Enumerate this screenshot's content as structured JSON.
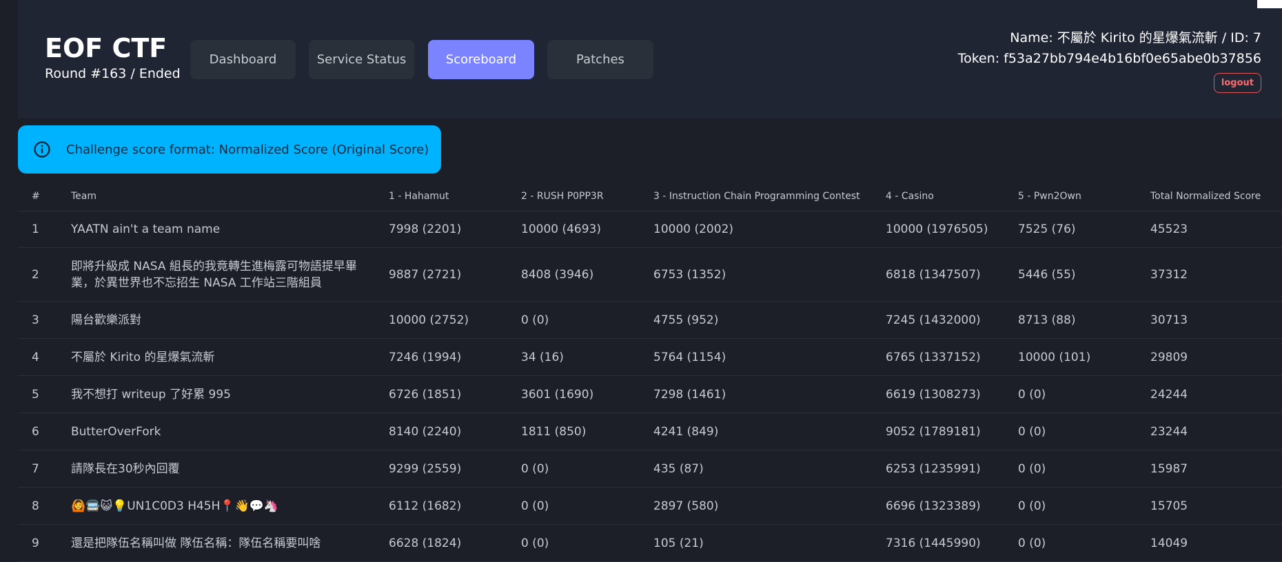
{
  "header": {
    "title": "EOF CTF",
    "round_status": "Round #163 / Ended",
    "nav": [
      {
        "label": "Dashboard",
        "active": false
      },
      {
        "label": "Service Status",
        "active": false
      },
      {
        "label": "Scoreboard",
        "active": true
      },
      {
        "label": "Patches",
        "active": false
      }
    ],
    "user_name_line": "Name: 不屬於 Kirito 的星爆氣流斬 / ID: 7",
    "token_line": "Token: f53a27bb794e4b16bf0e65abe0b37856",
    "logout_label": "logout"
  },
  "alert": {
    "icon": "info-icon",
    "text": "Challenge score format: Normalized Score (Original Score)"
  },
  "scoreboard": {
    "columns": [
      "#",
      "Team",
      "1 - Hahamut",
      "2 - RUSH P0PP3R",
      "3 - Instruction Chain Programming Contest",
      "4 - Casino",
      "5 - Pwn2Own",
      "Total Normalized Score"
    ],
    "rows": [
      {
        "rank": "1",
        "team": "YAATN ain't a team name",
        "c1": "7998 (2201)",
        "c2": "10000 (4693)",
        "c3": "10000 (2002)",
        "c4": "10000 (1976505)",
        "c5": "7525 (76)",
        "total": "45523"
      },
      {
        "rank": "2",
        "team": "即將升級成 NASA 組長的我竟轉生進梅露可物語提早畢業，於異世界也不忘招生 NASA 工作站三階組員",
        "c1": "9887 (2721)",
        "c2": "8408 (3946)",
        "c3": "6753 (1352)",
        "c4": "6818 (1347507)",
        "c5": "5446 (55)",
        "total": "37312"
      },
      {
        "rank": "3",
        "team": "陽台歡樂派對",
        "c1": "10000 (2752)",
        "c2": "0 (0)",
        "c3": "4755 (952)",
        "c4": "7245 (1432000)",
        "c5": "8713 (88)",
        "total": "30713"
      },
      {
        "rank": "4",
        "team": "不屬於 Kirito 的星爆氣流斬",
        "c1": "7246 (1994)",
        "c2": "34 (16)",
        "c3": "5764 (1154)",
        "c4": "6765 (1337152)",
        "c5": "10000 (101)",
        "total": "29809"
      },
      {
        "rank": "5",
        "team": "我不想打 writeup 了好累 995",
        "c1": "6726 (1851)",
        "c2": "3601 (1690)",
        "c3": "7298 (1461)",
        "c4": "6619 (1308273)",
        "c5": "0 (0)",
        "total": "24244"
      },
      {
        "rank": "6",
        "team": "ButterOverFork",
        "c1": "8140 (2240)",
        "c2": "1811 (850)",
        "c3": "4241 (849)",
        "c4": "9052 (1789181)",
        "c5": "0 (0)",
        "total": "23244"
      },
      {
        "rank": "7",
        "team": "請隊長在30秒內回覆",
        "c1": "9299 (2559)",
        "c2": "0 (0)",
        "c3": "435 (87)",
        "c4": "6253 (1235991)",
        "c5": "0 (0)",
        "total": "15987"
      },
      {
        "rank": "8",
        "team": "🙆🚍😺💡UN1C0D3 H45H📍👋💬🦄",
        "c1": "6112 (1682)",
        "c2": "0 (0)",
        "c3": "2897 (580)",
        "c4": "6696 (1323389)",
        "c5": "0 (0)",
        "total": "15705"
      },
      {
        "rank": "9",
        "team": "還是把隊伍名稱叫做 隊伍名稱：隊伍名稱要叫啥",
        "c1": "6628 (1824)",
        "c2": "0 (0)",
        "c3": "105 (21)",
        "c4": "7316 (1445990)",
        "c5": "0 (0)",
        "total": "14049"
      }
    ]
  }
}
